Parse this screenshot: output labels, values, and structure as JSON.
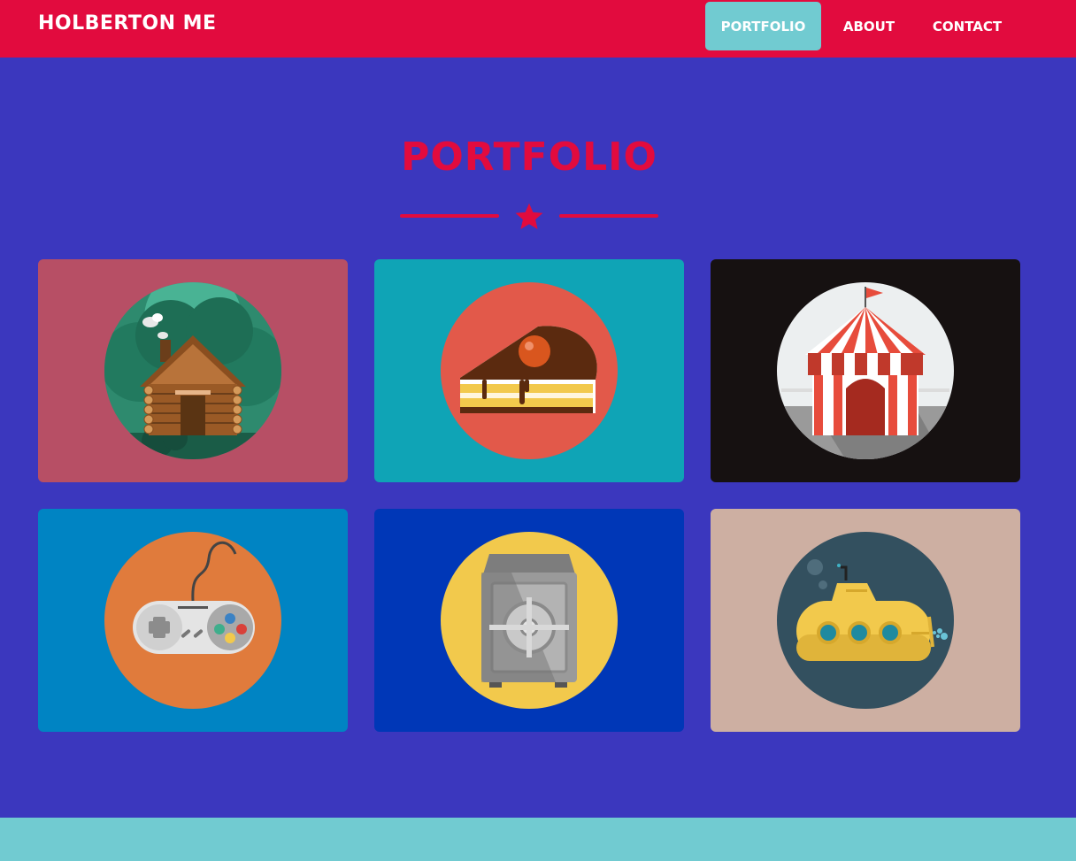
{
  "navbar": {
    "brand": "HOLBERTON ME",
    "links": [
      {
        "label": "PORTFOLIO",
        "active": true
      },
      {
        "label": "ABOUT",
        "active": false
      },
      {
        "label": "CONTACT",
        "active": false
      }
    ],
    "color": "#e20b3e"
  },
  "portfolio": {
    "title": "PORTFOLIO",
    "divider_icon": "star-icon",
    "items": [
      {
        "icon": "cabin-icon",
        "background": "#b74f65"
      },
      {
        "icon": "cake-icon",
        "background": "#0fa4b6"
      },
      {
        "icon": "circus-tent-icon",
        "background": "#161111"
      },
      {
        "icon": "game-controller-icon",
        "background": "#0084c3"
      },
      {
        "icon": "safe-icon",
        "background": "#0037b7"
      },
      {
        "icon": "submarine-icon",
        "background": "#cdafa2"
      }
    ]
  },
  "theme": {
    "page_background": "#3b37be",
    "accent": "#e20b3e",
    "footer": "#71cbd1"
  }
}
